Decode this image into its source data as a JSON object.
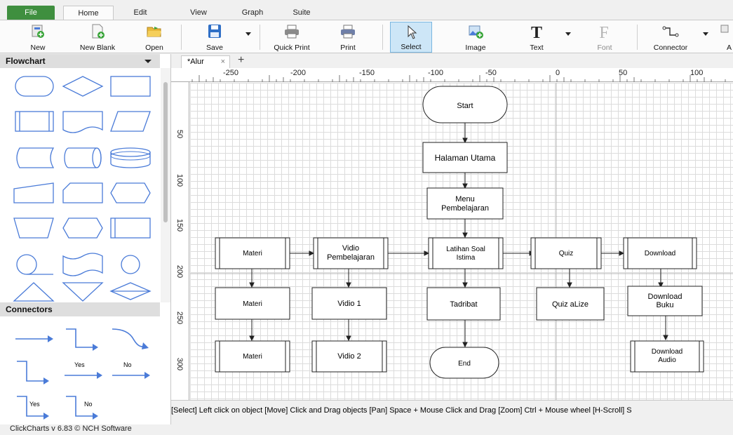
{
  "menu": {
    "file": "File",
    "tabs": [
      "Home",
      "Edit",
      "View",
      "Graph",
      "Suite"
    ]
  },
  "toolbar": {
    "new": "New",
    "new_blank": "New Blank",
    "open": "Open",
    "save": "Save",
    "quick_print": "Quick Print",
    "print": "Print",
    "select": "Select",
    "image": "Image",
    "text": "Text",
    "font": "Font",
    "connector": "Connector",
    "cut_off": "A"
  },
  "left_panel": {
    "flowchart_title": "Flowchart",
    "connectors_title": "Connectors",
    "connector_labels": [
      "Yes",
      "No",
      "Yes",
      "No"
    ]
  },
  "document": {
    "tab_name": "*Alur",
    "close_glyph": "×",
    "add_glyph": "+"
  },
  "ruler": {
    "top": [
      "-250",
      "-200",
      "-150",
      "-100",
      "-50",
      "0",
      "50",
      "100"
    ],
    "left": [
      "50",
      "100",
      "150",
      "200",
      "250",
      "300"
    ]
  },
  "diagram": {
    "start": "Start",
    "halaman_utama": "Halaman Utama",
    "menu_line1": "Menu",
    "menu_line2": "Pembelajaran",
    "materi1": "Materi",
    "vidio_line1": "Vidio",
    "vidio_line2": "Pembelajaran",
    "latihan_line1": "Latihan Soal",
    "latihan_line2": "Istima",
    "quiz": "Quiz",
    "download": "Download",
    "materi2": "Materi",
    "vidio1": "Vidio 1",
    "tadribat": "Tadribat",
    "quiz_alize": "Quiz aLize",
    "dlbuku_line1": "Download",
    "dlbuku_line2": "Buku",
    "materi3": "Materi",
    "vidio2": "Vidio 2",
    "end": "End",
    "dlaudio_line1": "Download",
    "dlaudio_line2": "Audio"
  },
  "status": {
    "hint": "[Select] Left click on object  [Move] Click and Drag objects  [Pan] Space + Mouse Click and Drag  [Zoom] Ctrl + Mouse wheel  [H-Scroll] S"
  },
  "footer": {
    "version": "ClickCharts v 6.83 © NCH Software"
  },
  "colors": {
    "file_tab": "#3f8f3f",
    "shape_stroke": "#4a7bd8",
    "select_bg": "#cde6f7"
  }
}
